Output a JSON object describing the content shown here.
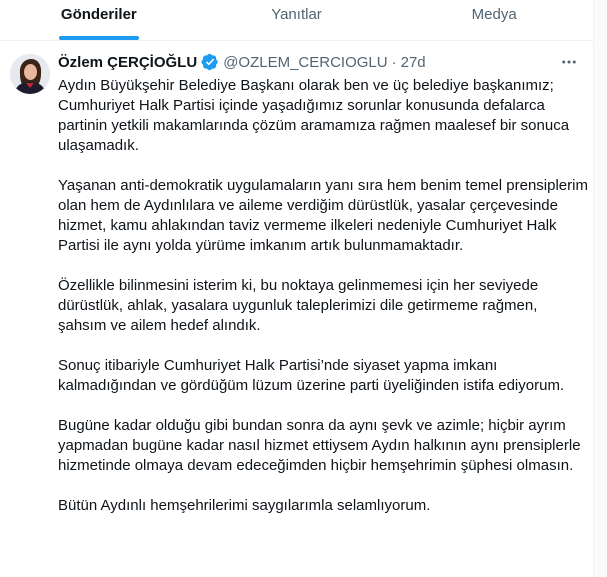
{
  "tabs": [
    {
      "label": "Gönderiler",
      "active": true
    },
    {
      "label": "Yanıtlar",
      "active": false
    },
    {
      "label": "Medya",
      "active": false
    }
  ],
  "accent_color": "#1d9bf0",
  "tweet": {
    "author_name": "Özlem ÇERÇİOĞLU",
    "verified": true,
    "handle": "@OZLEM_CERCIOGLU",
    "separator": "·",
    "time": "27d",
    "avatar_icon": "profile-photo",
    "more_icon": "more-horizontal-icon",
    "paragraphs": [
      "Aydın Büyükşehir Belediye Başkanı olarak ben ve üç belediye başkanımız; Cumhuriyet Halk Partisi içinde yaşadığımız sorunlar konusunda defalarca partinin yetkili makamlarında çözüm aramamıza rağmen maalesef bir sonuca ulaşamadık.",
      "Yaşanan anti-demokratik uygulamaların yanı sıra hem benim temel prensiplerim olan hem de Aydınlılara ve aileme verdiğim dürüstlük, yasalar çerçevesinde hizmet, kamu ahlakından taviz vermeme ilkeleri nedeniyle Cumhuriyet Halk Partisi ile aynı yolda yürüme imkanım artık bulunmamaktadır.",
      "Özellikle bilinmesini isterim ki, bu noktaya gelinmemesi için her seviyede dürüstlük, ahlak, yasalara uygunluk taleplerimizi dile getirmeme rağmen, şahsım ve ailem hedef alındık.",
      "Sonuç itibariyle Cumhuriyet Halk Partisi’nde siyaset yapma imkanı kalmadığından ve gördüğüm lüzum üzerine parti üyeliğinden istifa ediyorum.",
      "Bugüne kadar olduğu gibi bundan sonra da aynı şevk ve azimle; hiçbir ayrım yapmadan bugüne kadar nasıl hizmet ettiysem Aydın halkının aynı prensiplerle hizmetinde olmaya devam edeceğimden hiçbir hemşehrimin şüphesi olmasın.",
      "Bütün Aydınlı hemşehrilerimi saygılarımla selamlıyorum."
    ]
  }
}
